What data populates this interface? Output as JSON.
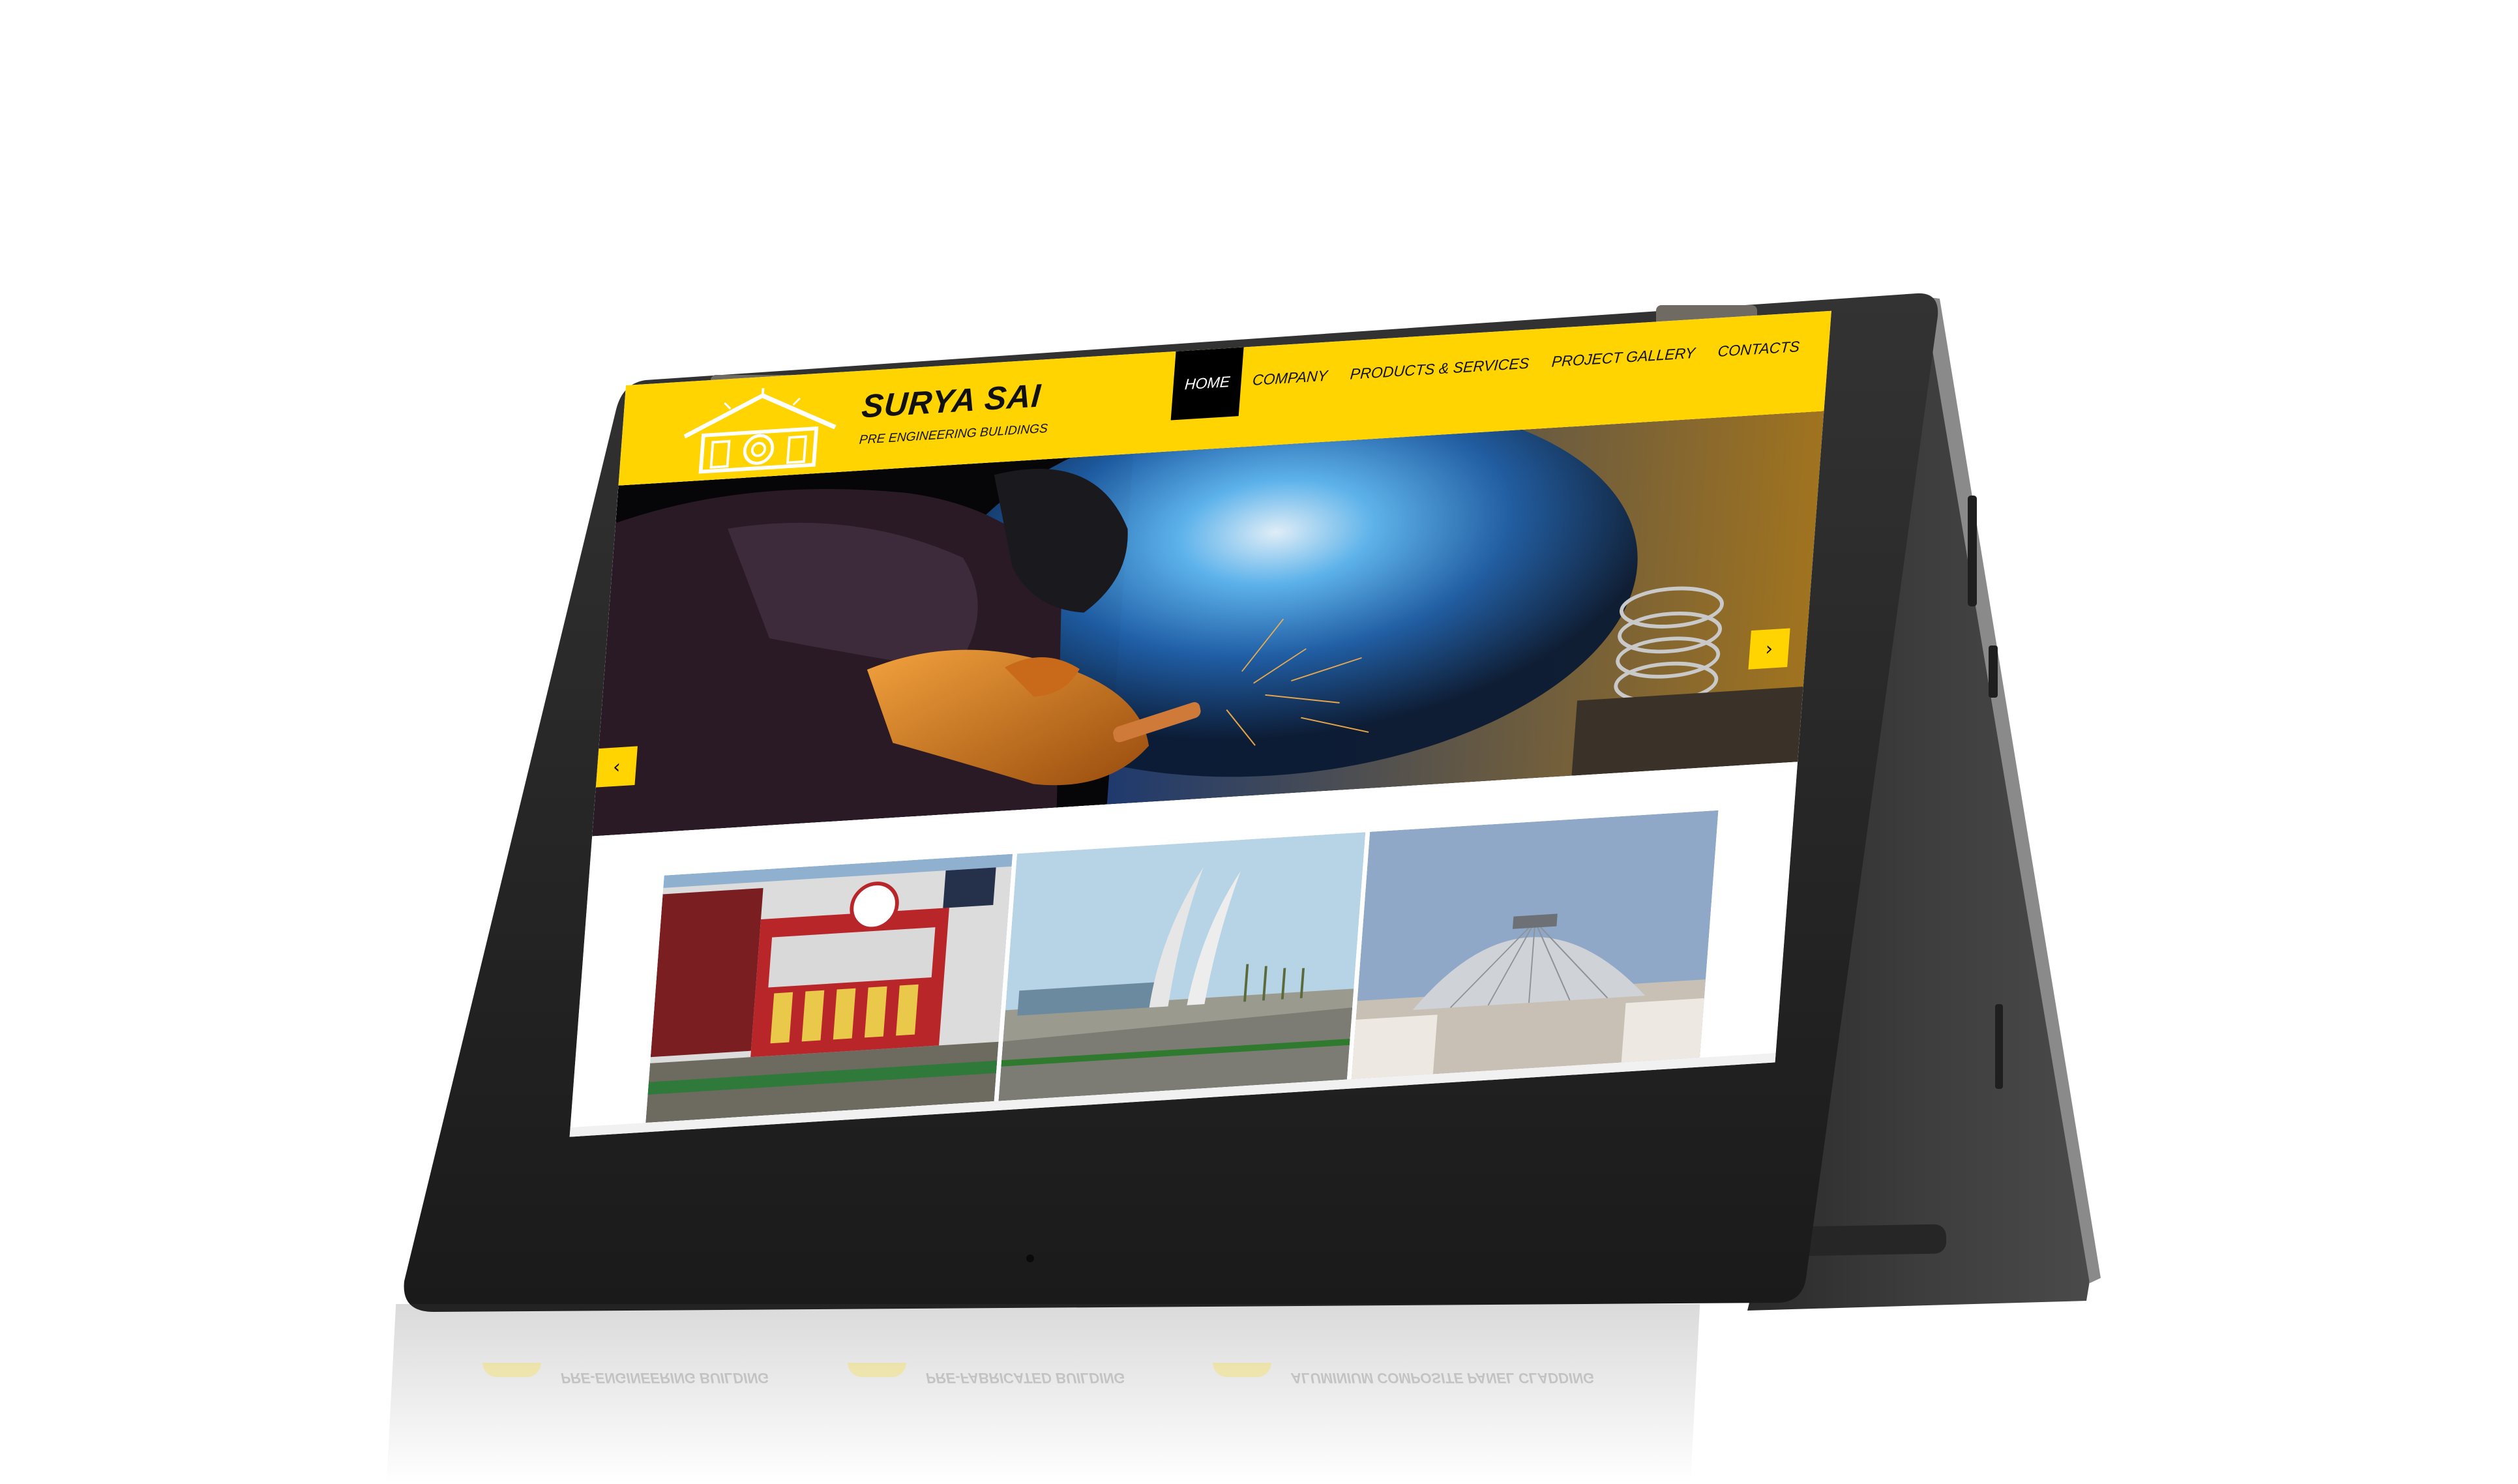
{
  "site": {
    "brand_name": "SURYA SAI",
    "tagline": "PRE ENGINEERING BULIDINGS"
  },
  "nav": {
    "items": [
      {
        "label": "HOME",
        "active": true
      },
      {
        "label": "COMPANY",
        "active": false
      },
      {
        "label": "PRODUCTS & SERVICES",
        "active": false
      },
      {
        "label": "PROJECT GALLERY",
        "active": false
      },
      {
        "label": "CONTACTS",
        "active": false
      }
    ]
  },
  "slider": {
    "prev_glyph": "‹",
    "next_glyph": "›",
    "image_icon": "welding-sparks-photo"
  },
  "gallery": {
    "cards": [
      {
        "image_icon": "shopping-mall-facade-photo"
      },
      {
        "image_icon": "curved-arch-gateway-photo"
      },
      {
        "image_icon": "aluminium-dome-roof-photo"
      }
    ]
  },
  "features": {
    "items": [
      {
        "label": "PRE-ENGINEERING BUILDING"
      },
      {
        "label": "PRE-FABRICATED BUILDING"
      },
      {
        "label": "ALUMINIUM COMPOSITE PANEL CLADDING"
      }
    ]
  },
  "colors": {
    "accent": "#ffd400",
    "device_body": "#3a3a3a",
    "device_bezel": "#1c1c1c"
  }
}
